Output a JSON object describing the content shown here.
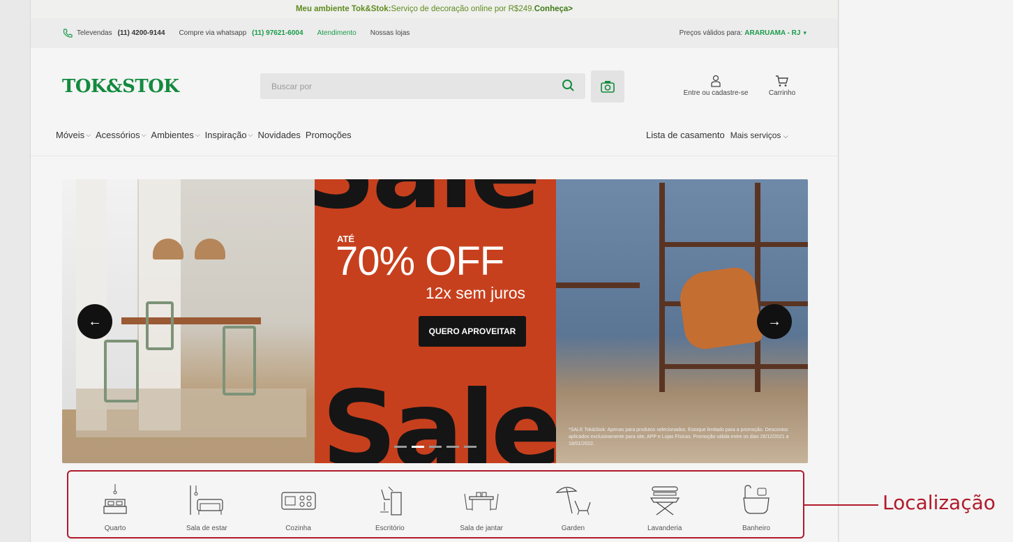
{
  "promo": {
    "lead": "Meu ambiente Tok&Stok:",
    "text": " Serviço de decoração online por R$249. ",
    "link": "Conheça>"
  },
  "topbar": {
    "televendas_label": "Televendas",
    "televendas_phone": "(11) 4200-9144",
    "whatsapp_label": "Compre via whatsapp",
    "whatsapp_phone": "(11) 97621-6004",
    "atendimento": "Atendimento",
    "lojas": "Nossas lojas",
    "prices_label": "Preços válidos para:",
    "city": "ARARUAMA - RJ"
  },
  "header": {
    "logo": "TOK&STOK",
    "search_placeholder": "Buscar por",
    "account_label": "Entre ou cadastre-se",
    "cart_label": "Carrinho"
  },
  "nav": {
    "items": [
      {
        "label": "Móveis",
        "dropdown": true
      },
      {
        "label": "Acessórios",
        "dropdown": true
      },
      {
        "label": "Ambientes",
        "dropdown": true
      },
      {
        "label": "Inspiração",
        "dropdown": true
      },
      {
        "label": "Novidades",
        "dropdown": false
      },
      {
        "label": "Promoções",
        "dropdown": false
      }
    ],
    "wedding_list": "Lista de casamento",
    "more_services": "Mais serviços"
  },
  "banner": {
    "top_word": "Sale",
    "bottom_word": "Sale",
    "ate": "ATÉ",
    "discount": "70% OFF",
    "installments": "12x sem juros",
    "cta": "QUERO APROVEITAR",
    "disclaimer": "*SALE Tok&Stok: Apenas para produtos selecionados. Estoque limitado para a promoção. Descontos aplicados exclusivamente para site, APP e Lojas Físicas. Promoção válida entre os dias 26/12/2021 a 18/01/2022.",
    "slide_count": 5,
    "active_slide": 2
  },
  "categories": [
    {
      "label": "Quarto",
      "icon": "bed-icon"
    },
    {
      "label": "Sala de estar",
      "icon": "sofa-icon"
    },
    {
      "label": "Cozinha",
      "icon": "stove-icon"
    },
    {
      "label": "Escritório",
      "icon": "desk-chair-icon"
    },
    {
      "label": "Sala de jantar",
      "icon": "dining-table-icon"
    },
    {
      "label": "Garden",
      "icon": "umbrella-chair-icon"
    },
    {
      "label": "Lavanderia",
      "icon": "ironing-board-icon"
    },
    {
      "label": "Banheiro",
      "icon": "bathtub-icon"
    }
  ],
  "annotation": {
    "callout": "Localização"
  },
  "colors": {
    "brand_green": "#138a3e",
    "sale_orange": "#c7401e",
    "annotation_red": "#b11a2b"
  }
}
